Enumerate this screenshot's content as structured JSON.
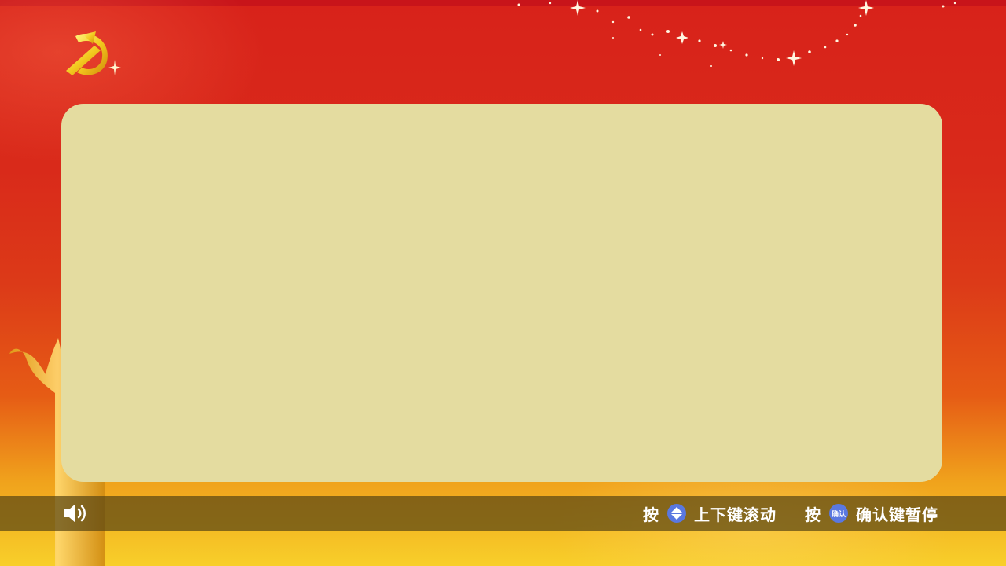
{
  "content": {
    "text": ""
  },
  "bottom_bar": {
    "volume_icon": "speaker-icon",
    "scroll_hint": {
      "prefix": "按",
      "key_icon": "up-down-arrows-icon",
      "text": "上下键滚动"
    },
    "pause_hint": {
      "prefix": "按",
      "key_label": "确认",
      "text": "确认键暂停"
    }
  },
  "colors": {
    "background_top": "#d8221a",
    "background_bottom": "#f8cf2a",
    "panel": "#e4dca0",
    "key_badge": "#5a78e0",
    "hint_text": "#ffffff"
  }
}
